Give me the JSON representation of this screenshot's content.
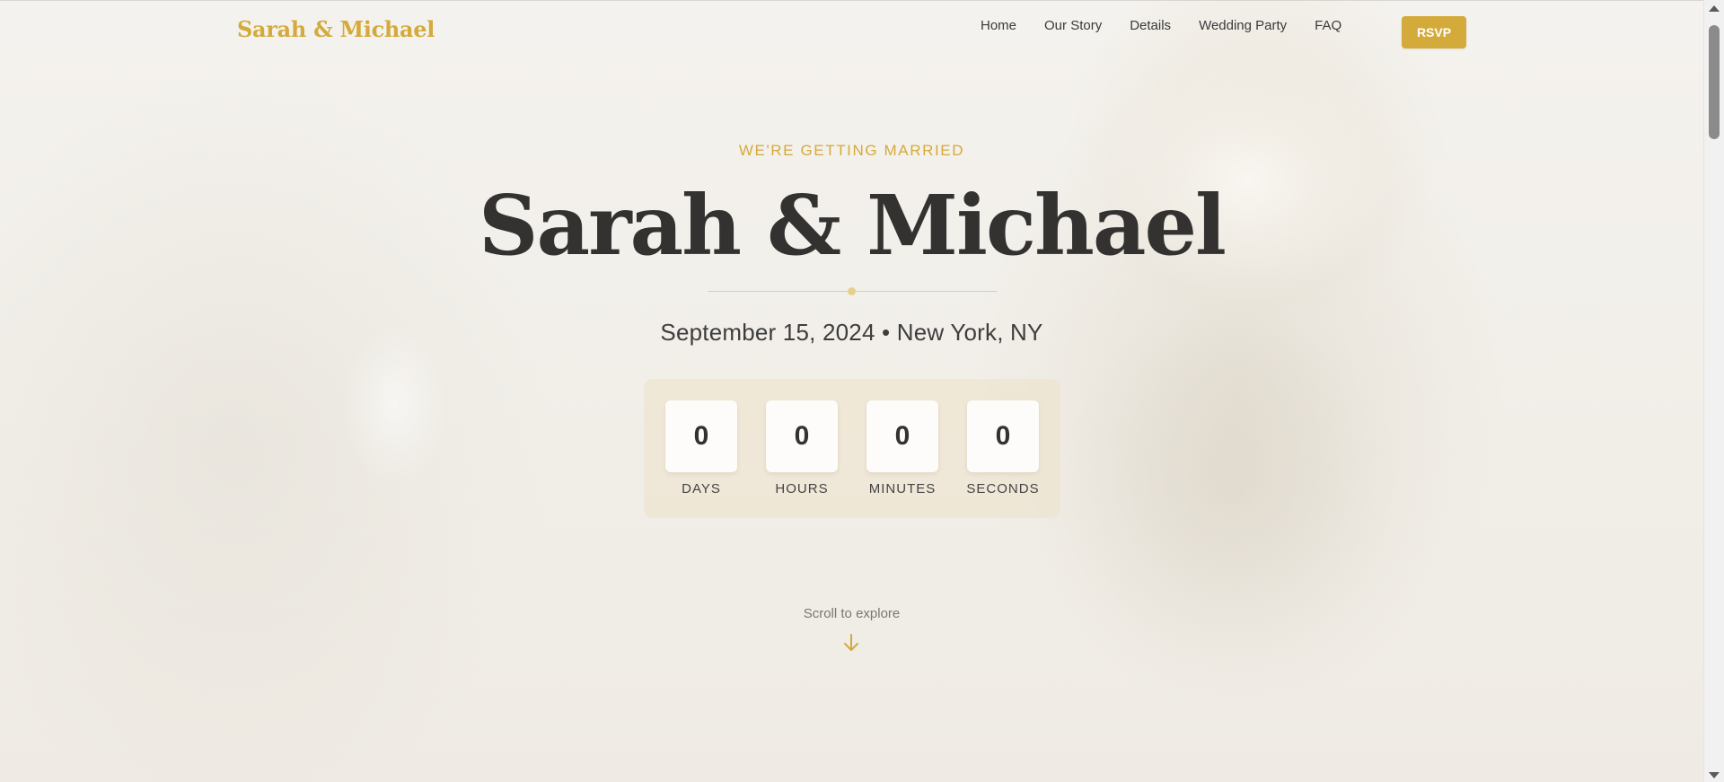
{
  "nav": {
    "brand": "Sarah & Michael",
    "links": [
      "Home",
      "Our Story",
      "Details",
      "Wedding Party",
      "FAQ"
    ],
    "rsvp_label": "RSVP"
  },
  "hero": {
    "eyebrow": "WE'RE GETTING MARRIED",
    "title": "Sarah & Michael",
    "date_location": "September 15, 2024 • New York, NY"
  },
  "countdown": {
    "units": [
      {
        "value": "0",
        "label": "DAYS"
      },
      {
        "value": "0",
        "label": "HOURS"
      },
      {
        "value": "0",
        "label": "MINUTES"
      },
      {
        "value": "0",
        "label": "SECONDS"
      }
    ]
  },
  "scroll": {
    "text": "Scroll to explore",
    "icon": "arrow-down-icon"
  },
  "colors": {
    "accent": "#d4aa3a",
    "title": "#333230",
    "background": "#f2efea"
  }
}
